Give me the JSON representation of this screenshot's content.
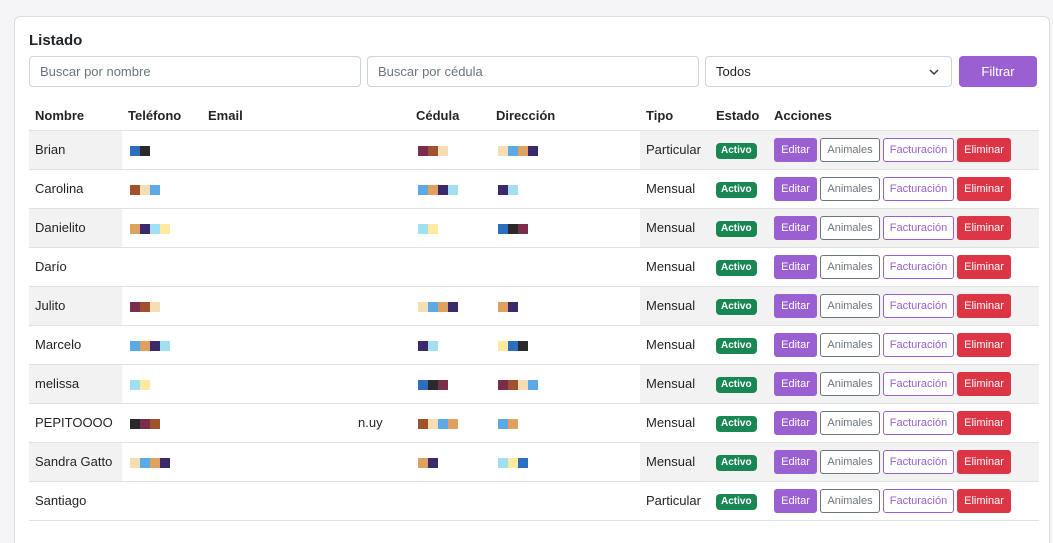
{
  "listado": {
    "title": "Listado",
    "search_name_placeholder": "Buscar por nombre",
    "search_cedula_placeholder": "Buscar por cédula",
    "tipo_select_value": "Todos",
    "filter_button": "Filtrar"
  },
  "table": {
    "headers": {
      "nombre": "Nombre",
      "telefono": "Teléfono",
      "email": "Email",
      "cedula": "Cédula",
      "direccion": "Dirección",
      "tipo": "Tipo",
      "estado": "Estado",
      "acciones": "Acciones"
    },
    "actions": {
      "edit": "Editar",
      "animals": "Animales",
      "billing": "Facturación",
      "delete": "Eliminar"
    },
    "rows": [
      {
        "nombre": "Brian",
        "email": "",
        "tipo": "Particular",
        "estado": "Activo"
      },
      {
        "nombre": "Carolina",
        "email": "",
        "tipo": "Mensual",
        "estado": "Activo"
      },
      {
        "nombre": "Danielito",
        "email": "",
        "tipo": "Mensual",
        "estado": "Activo"
      },
      {
        "nombre": "Darío",
        "email": "",
        "tipo": "Mensual",
        "estado": "Activo"
      },
      {
        "nombre": "Julito",
        "email": "",
        "tipo": "Mensual",
        "estado": "Activo"
      },
      {
        "nombre": "Marcelo",
        "email": "",
        "tipo": "Mensual",
        "estado": "Activo"
      },
      {
        "nombre": "melissa",
        "email": "",
        "tipo": "Mensual",
        "estado": "Activo"
      },
      {
        "nombre": "PEPITOOOO",
        "email": "n.uy",
        "tipo": "Mensual",
        "estado": "Activo"
      },
      {
        "nombre": "Sandra Gatto",
        "email": "",
        "tipo": "Mensual",
        "estado": "Activo"
      },
      {
        "nombre": "Santiago",
        "email": "",
        "tipo": "Particular",
        "estado": "Activo"
      }
    ]
  },
  "colors": {
    "primary_purple": "#9a5fd1",
    "success_badge": "#198754",
    "danger": "#dc3545",
    "secondary": "#6c757d"
  },
  "icons": {
    "select_chevron": "chevron-down-icon"
  }
}
